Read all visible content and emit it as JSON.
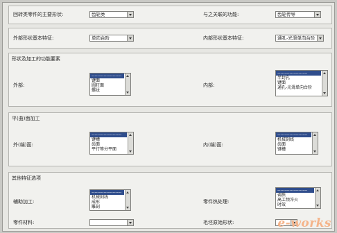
{
  "row1": {
    "main_shape_label": "回转类零件的主要形状:",
    "main_shape_value": "齿轮类",
    "relation_label": "与之关联的功能:",
    "relation_value": "齿轮传导"
  },
  "row2": {
    "outer_feature_label": "外部形状基本特征:",
    "outer_feature_value": "单向台阶",
    "inner_feature_label": "内部形状基本特征:",
    "inner_feature_value": "通孔-光滑单向台阶"
  },
  "shape_section": {
    "title": "形状及加工的功能要素",
    "outer_label": "外部:",
    "outer_items": [
      "",
      "键面",
      "圆柱面",
      "螺纹"
    ],
    "inner_label": "内部:",
    "inner_items": [
      "",
      "半封孔",
      "键面",
      "通孔-光滑单向台阶"
    ]
  },
  "surface_section": {
    "title": "平(曲)面加工",
    "outer_label": "外(端)面:",
    "outer_items": [
      "",
      "键槽",
      "齿面",
      "平行等分平面"
    ],
    "inner_label": "内(端)面:",
    "inner_items": [
      "",
      "机械刻线",
      "齿面",
      "键槽"
    ]
  },
  "other_section": {
    "title": "其他特征选项",
    "aux_label": "辅助加工:",
    "aux_items": [
      "",
      "机械刻线",
      "成形",
      "雕刻"
    ],
    "heat_label": "零件热处理:",
    "heat_items": [
      "",
      "调质",
      "高工频淬火",
      "时效"
    ],
    "material_label": "零件材料:",
    "material_value": "",
    "blank_label": "毛坯原始形状:",
    "blank_value": ""
  },
  "watermark": "e-works"
}
